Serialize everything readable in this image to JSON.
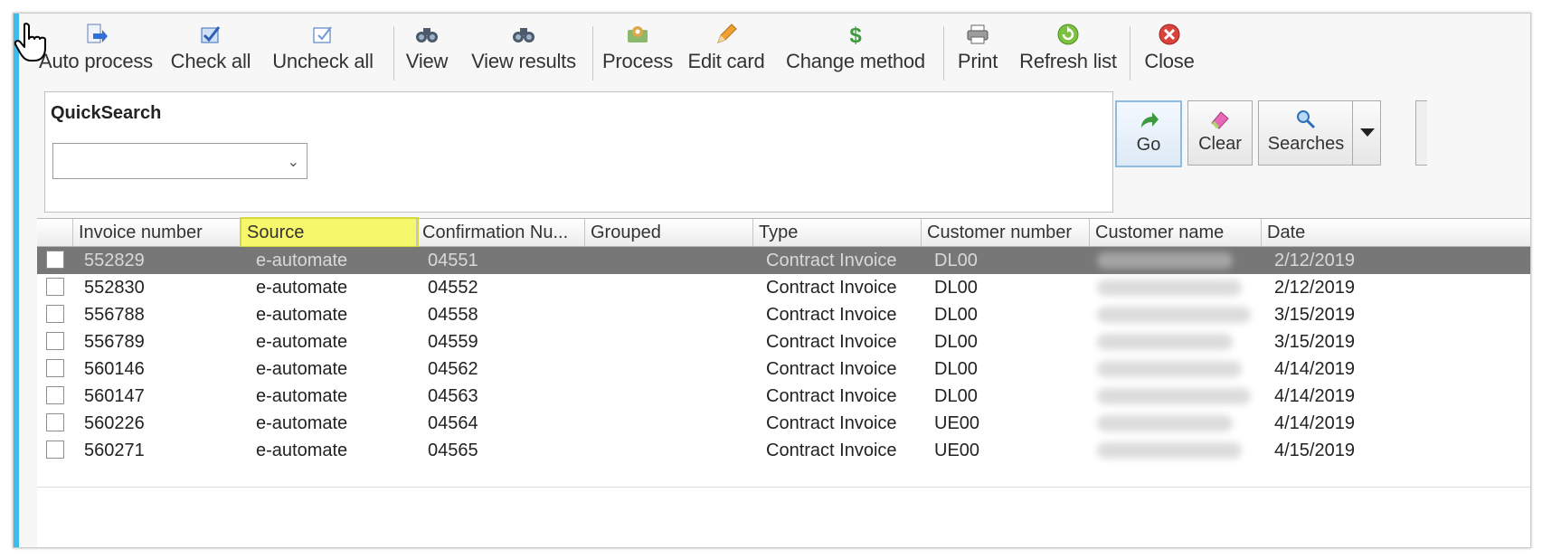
{
  "toolbar": {
    "buttons": [
      {
        "label": "Auto process",
        "icon": "auto-process-icon"
      },
      {
        "label": "Check all",
        "icon": "check-all-icon"
      },
      {
        "label": "Uncheck all",
        "icon": "uncheck-all-icon"
      },
      {
        "label": "View",
        "icon": "binoculars-icon"
      },
      {
        "label": "View results",
        "icon": "binoculars-results-icon"
      },
      {
        "label": "Process",
        "icon": "process-icon"
      },
      {
        "label": "Edit card",
        "icon": "pencil-icon"
      },
      {
        "label": "Change method",
        "icon": "dollar-icon"
      },
      {
        "label": "Print",
        "icon": "printer-icon"
      },
      {
        "label": "Refresh list",
        "icon": "refresh-icon"
      },
      {
        "label": "Close",
        "icon": "close-icon"
      }
    ]
  },
  "quicksearch": {
    "title": "QuickSearch",
    "value": ""
  },
  "actions": {
    "go": "Go",
    "clear": "Clear",
    "searches": "Searches"
  },
  "grid": {
    "columns": [
      "Invoice number",
      "Source",
      "Confirmation Nu...",
      "Grouped",
      "Type",
      "Customer number",
      "Customer name",
      "Date"
    ],
    "highlighted_column": "Source",
    "rows": [
      {
        "invoice": "552829",
        "source": "e-automate",
        "confirmation": "04551",
        "grouped": "",
        "type": "Contract Invoice",
        "customer_number": "DL00",
        "date": "2/12/2019",
        "selected": true
      },
      {
        "invoice": "552830",
        "source": "e-automate",
        "confirmation": "04552",
        "grouped": "",
        "type": "Contract Invoice",
        "customer_number": "DL00",
        "date": "2/12/2019",
        "selected": false
      },
      {
        "invoice": "556788",
        "source": "e-automate",
        "confirmation": "04558",
        "grouped": "",
        "type": "Contract Invoice",
        "customer_number": "DL00",
        "date": "3/15/2019",
        "selected": false
      },
      {
        "invoice": "556789",
        "source": "e-automate",
        "confirmation": "04559",
        "grouped": "",
        "type": "Contract Invoice",
        "customer_number": "DL00",
        "date": "3/15/2019",
        "selected": false
      },
      {
        "invoice": "560146",
        "source": "e-automate",
        "confirmation": "04562",
        "grouped": "",
        "type": "Contract Invoice",
        "customer_number": "DL00",
        "date": "4/14/2019",
        "selected": false
      },
      {
        "invoice": "560147",
        "source": "e-automate",
        "confirmation": "04563",
        "grouped": "",
        "type": "Contract Invoice",
        "customer_number": "DL00",
        "date": "4/14/2019",
        "selected": false
      },
      {
        "invoice": "560226",
        "source": "e-automate",
        "confirmation": "04564",
        "grouped": "",
        "type": "Contract Invoice",
        "customer_number": "UE00",
        "date": "4/14/2019",
        "selected": false
      },
      {
        "invoice": "560271",
        "source": "e-automate",
        "confirmation": "04565",
        "grouped": "",
        "type": "Contract Invoice",
        "customer_number": "UE00",
        "date": "4/15/2019",
        "selected": false
      }
    ]
  },
  "colors": {
    "accent": "#3cbcea",
    "selected_row": "#777777",
    "highlight": "#f6f76a"
  }
}
